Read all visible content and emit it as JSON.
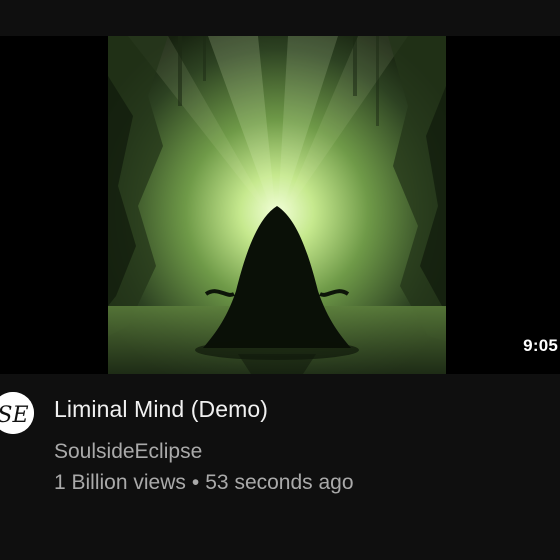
{
  "video": {
    "duration": "9:05",
    "title": "Liminal Mind (Demo)",
    "channel": "SoulsideEclipse",
    "views": "1 Billion views",
    "separator": "•",
    "age": "53 seconds ago"
  },
  "avatar": {
    "monogram": "SE"
  },
  "colors": {
    "background": "#0f0f0f",
    "title": "#f1f1f1",
    "secondary_text": "#aaaaaa",
    "thumbnail_accent": "#8fd16a"
  }
}
